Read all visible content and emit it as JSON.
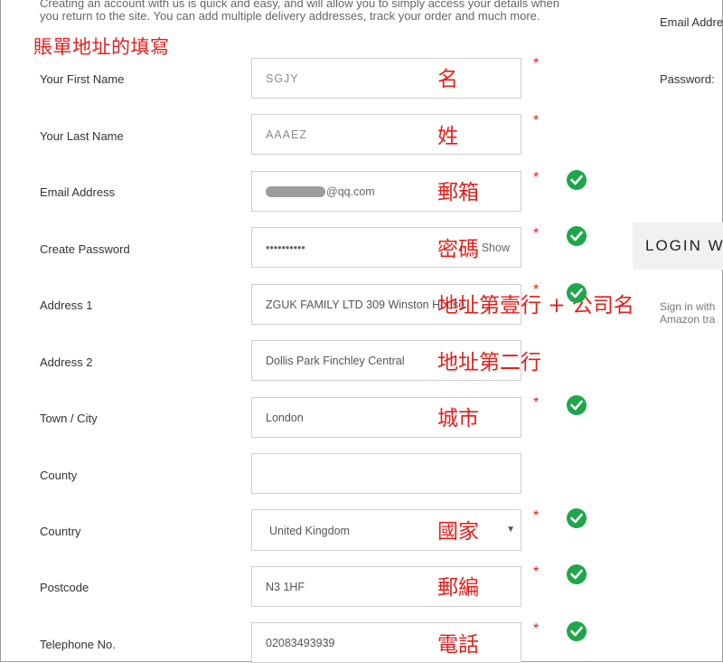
{
  "intro": {
    "line1": "Creating an account with us is quick and easy, and will allow you to simply access your details when",
    "line2": "you return to the site. You can add multiple delivery addresses, track your order and much more."
  },
  "section_title": "賬單地址的填寫",
  "fields": {
    "first_name": {
      "label": "Your First Name",
      "value": "SGJY",
      "annotation": "名"
    },
    "last_name": {
      "label": "Your Last Name",
      "value": "AAAEZ",
      "annotation": "姓"
    },
    "email": {
      "label": "Email Address",
      "value": "@qq.com",
      "annotation": "郵箱"
    },
    "password": {
      "label": "Create Password",
      "value": "••••••••••",
      "show_label": "Show",
      "annotation": "密碼"
    },
    "address1": {
      "label": "Address 1",
      "value": "ZGUK FAMILY LTD 309 Winston House",
      "annotation": "地址第壹行 + 公司名"
    },
    "address2": {
      "label": "Address 2",
      "value": "Dollis Park Finchley Central",
      "annotation": "地址第二行"
    },
    "town": {
      "label": "Town / City",
      "value": "London",
      "annotation": "城市"
    },
    "county": {
      "label": "County",
      "value": ""
    },
    "country": {
      "label": "Country",
      "value": "United Kingdom",
      "annotation": "國家"
    },
    "postcode": {
      "label": "Postcode",
      "value": "N3 1HF",
      "annotation": "郵編"
    },
    "telephone": {
      "label": "Telephone No.",
      "value": "02083493939",
      "annotation": "電話"
    }
  },
  "required_mark": "*",
  "right_panel": {
    "email_label": "Email Addre",
    "password_label": "Password:",
    "login_label": "LOGIN W",
    "signin_line1": "Sign in with",
    "signin_line2": "Amazon tra"
  },
  "colors": {
    "accent_red": "#e0201c",
    "check_green": "#1fa64a",
    "field_border": "#cfcfcf"
  },
  "icons": {
    "valid": "check-circle-icon",
    "dropdown": "caret-down-icon"
  }
}
